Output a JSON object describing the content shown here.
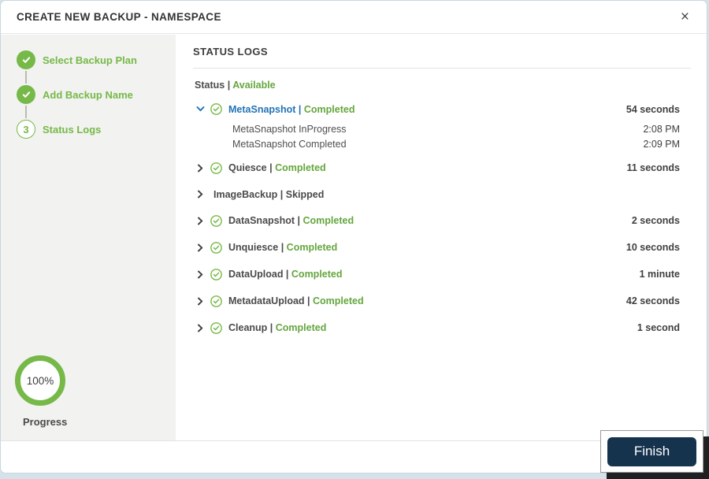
{
  "dialog": {
    "title": "CREATE NEW BACKUP - NAMESPACE",
    "close_glyph": "×"
  },
  "steps": [
    {
      "label": "Select Backup Plan",
      "state": "done"
    },
    {
      "label": "Add Backup Name",
      "state": "done"
    },
    {
      "label": "Status Logs",
      "state": "current",
      "number": "3"
    }
  ],
  "progress": {
    "percent": "100%",
    "label": "Progress"
  },
  "main": {
    "heading": "STATUS LOGS",
    "status_label": "Status",
    "pipe": "|",
    "status_value": "Available",
    "rows": [
      {
        "name": "MetaSnapshot",
        "status": "Completed",
        "duration": "54 seconds",
        "expanded": true,
        "has_check": true,
        "children": [
          {
            "text": "MetaSnapshot InProgress",
            "time": "2:08 PM"
          },
          {
            "text": "MetaSnapshot Completed",
            "time": "2:09 PM"
          }
        ]
      },
      {
        "name": "Quiesce",
        "status": "Completed",
        "duration": "11 seconds",
        "expanded": false,
        "has_check": true
      },
      {
        "name": "ImageBackup",
        "status": "Skipped",
        "duration": "",
        "expanded": false,
        "has_check": false
      },
      {
        "name": "DataSnapshot",
        "status": "Completed",
        "duration": "2 seconds",
        "expanded": false,
        "has_check": true
      },
      {
        "name": "Unquiesce",
        "status": "Completed",
        "duration": "10 seconds",
        "expanded": false,
        "has_check": true
      },
      {
        "name": "DataUpload",
        "status": "Completed",
        "duration": "1 minute",
        "expanded": false,
        "has_check": true
      },
      {
        "name": "MetadataUpload",
        "status": "Completed",
        "duration": "42 seconds",
        "expanded": false,
        "has_check": true
      },
      {
        "name": "Cleanup",
        "status": "Completed",
        "duration": "1 second",
        "expanded": false,
        "has_check": true
      }
    ]
  },
  "footer": {
    "finish_label": "Finish"
  },
  "colors": {
    "green": "#76b948",
    "status_green": "#64a63d",
    "blue": "#2273b5",
    "navy": "#16334e",
    "sidebar_bg": "#f2f2f0",
    "dialog_border": "#c6d7e0"
  }
}
